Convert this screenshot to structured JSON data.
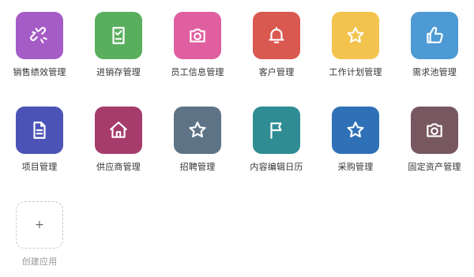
{
  "apps": [
    {
      "label": "销售绩效管理",
      "icon": "broken-link-icon",
      "color": "#a65cc7"
    },
    {
      "label": "进销存管理",
      "icon": "checklist-icon",
      "color": "#5aaf5f"
    },
    {
      "label": "员工信息管理",
      "icon": "camera-icon",
      "color": "#e05fa0"
    },
    {
      "label": "客户管理",
      "icon": "bell-icon",
      "color": "#d9584f"
    },
    {
      "label": "工作计划管理",
      "icon": "star-icon",
      "color": "#f2c34d"
    },
    {
      "label": "需求池管理",
      "icon": "thumbs-up-icon",
      "color": "#4d9ad4"
    },
    {
      "label": "项目管理",
      "icon": "document-icon",
      "color": "#4c53b7"
    },
    {
      "label": "供应商管理",
      "icon": "home-icon",
      "color": "#a53c6c"
    },
    {
      "label": "招聘管理",
      "icon": "star-icon",
      "color": "#5e7486"
    },
    {
      "label": "内容编辑日历",
      "icon": "flag-icon",
      "color": "#2f8c93"
    },
    {
      "label": "采购管理",
      "icon": "star-icon",
      "color": "#2f71b7"
    },
    {
      "label": "固定资产管理",
      "icon": "camera-icon",
      "color": "#785860"
    }
  ],
  "create": {
    "label": "创建应用",
    "icon": "plus-icon",
    "symbol": "+"
  }
}
